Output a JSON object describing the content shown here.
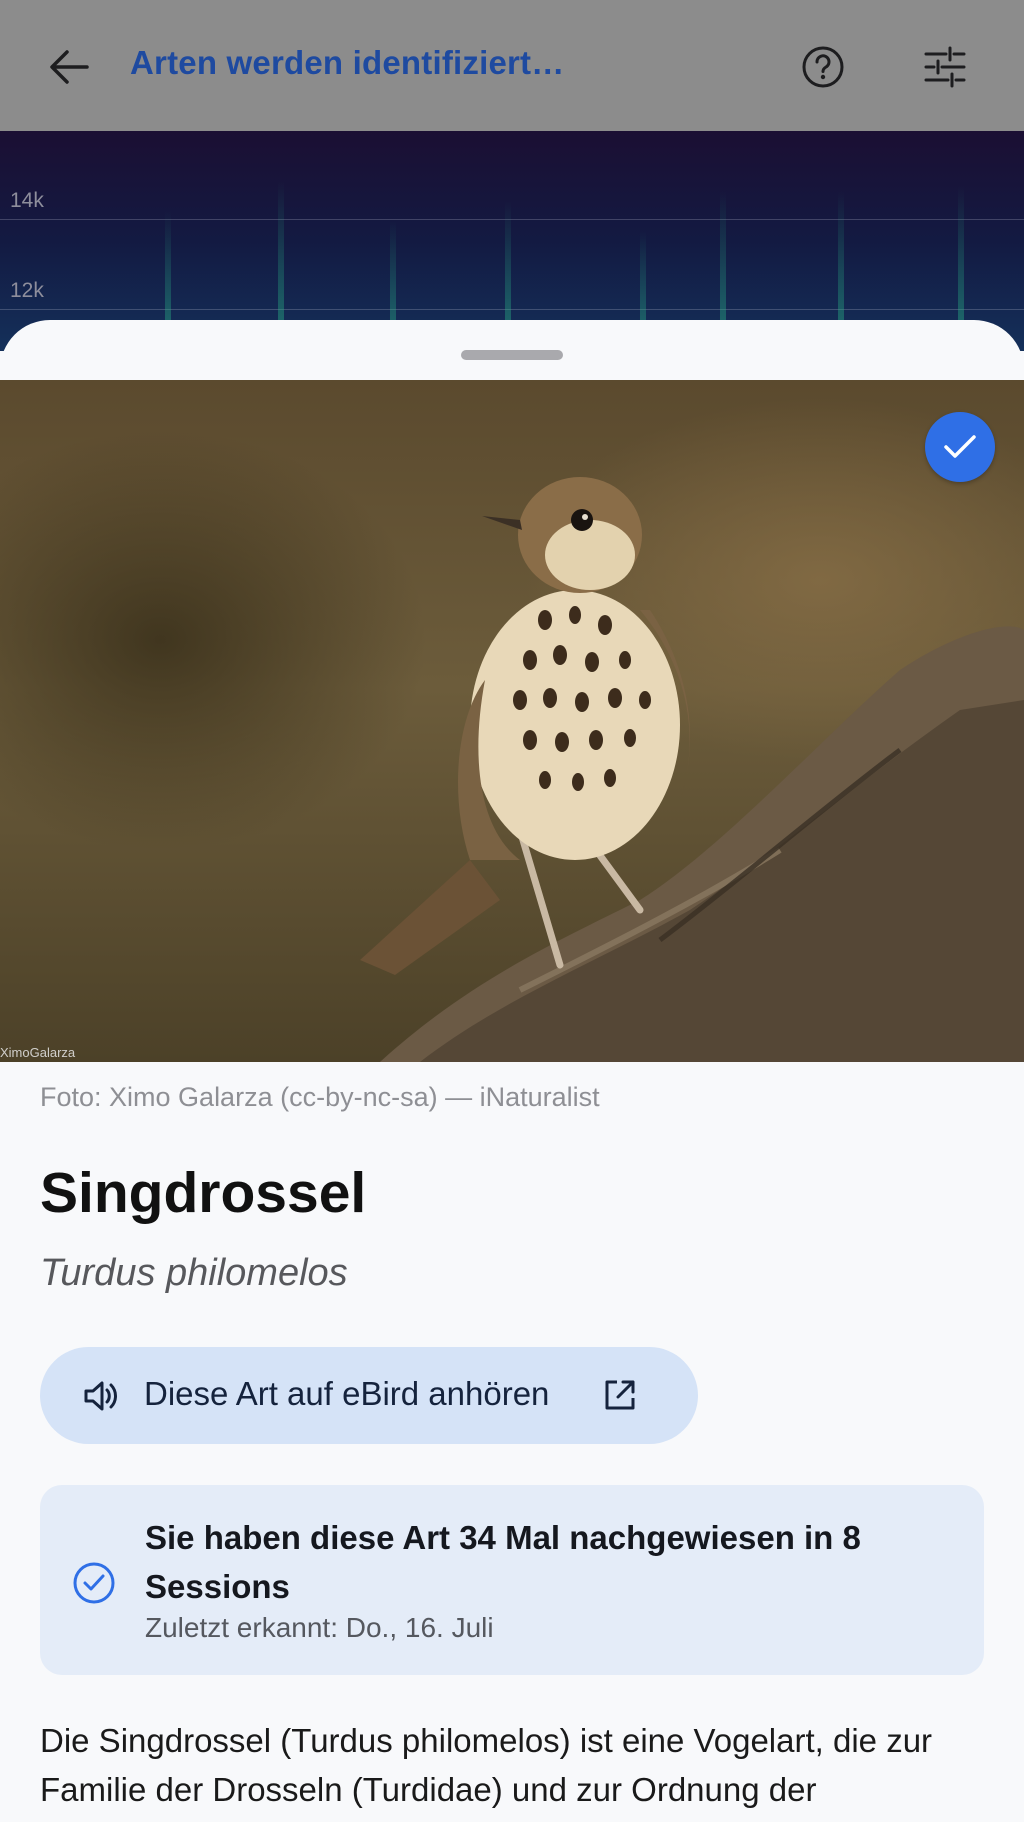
{
  "appbar": {
    "title": "Arten werden identifiziert…",
    "back_icon": "arrow-back-icon",
    "help_icon": "help-circle-icon",
    "filter_icon": "tune-sliders-icon"
  },
  "spectrogram": {
    "ticks": [
      "14k",
      "12k"
    ]
  },
  "species": {
    "photo_watermark": "XimoGalarza",
    "photo_credit": "Foto: Ximo Galarza (cc-by-nc-sa) — iNaturalist",
    "common_name": "Singdrossel",
    "scientific_name": "Turdus philomelos",
    "selected_icon": "check-icon"
  },
  "ebird": {
    "label": "Diese Art auf eBird anhören",
    "speaker_icon": "speaker-icon",
    "external_icon": "open-external-icon"
  },
  "stats": {
    "headline": "Sie haben diese Art 34 Mal nachgewiesen in 8 Sessions",
    "last_seen": "Zuletzt erkannt: Do., 16. Juli",
    "icon": "check-circle-icon"
  },
  "description": "Die Singdrossel (Turdus philomelos) ist eine Vogelart, die zur Familie der Drosseln (Turdidae) und zur Ordnung der",
  "colors": {
    "accent": "#2f6fe6",
    "title_blue": "#1e4aa0",
    "chip_bg": "#d5e3f7",
    "card_bg": "#e4ecf8"
  }
}
